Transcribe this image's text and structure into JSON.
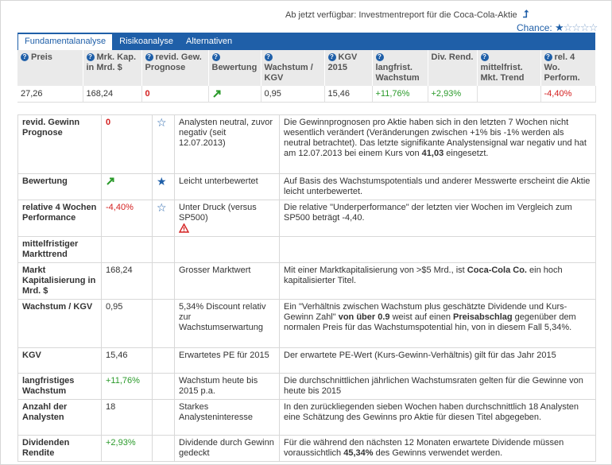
{
  "header": {
    "report_link": "Ab jetzt verfügbar: Investmentreport für die Coca-Cola-Aktie",
    "chance_label": "Chance:",
    "chance_stars_filled": 1,
    "chance_stars_total": 5
  },
  "tabs": [
    {
      "label": "Fundamentalanalyse",
      "active": true
    },
    {
      "label": "Risikoanalyse",
      "active": false
    },
    {
      "label": "Alternativen",
      "active": false
    }
  ],
  "summary": {
    "headers": [
      "Preis",
      "Mrk. Kap. in Mrd. $",
      "revid. Gew. Prognose",
      "Bewertung",
      "Wachstum / KGV",
      "KGV 2015",
      "langfrist. Wachstum",
      "Div. Rend.",
      "mittelfrist. Mkt. Trend",
      "rel. 4 Wo. Perform."
    ],
    "values": {
      "preis": "27,26",
      "mrk_kap": "168,24",
      "revid": "0",
      "bewertung": "",
      "wachstum_kgv": "0,95",
      "kgv": "15,46",
      "langfrist": "+11,76%",
      "div_rend": "+2,93%",
      "mittelfrist": "",
      "rel_perf": "-4,40%"
    }
  },
  "detail": {
    "rows": [
      {
        "label": "revid. Gewinn Prognose",
        "value": "0",
        "star": "empty",
        "short": "Analysten neutral, zuvor negativ (seit 12.07.2013)",
        "long_a": "Die Gewinnprognosen pro Aktie haben sich in den letzten 7 Wochen nicht wesentlich verändert (Veränderungen zwischen +1% bis -1% werden als neutral betrachtet). Das letzte signifikante Analystensignal war negativ und hat am 12.07.2013 bei einem Kurs von ",
        "long_b": "41,03",
        "long_c": " eingesetzt."
      },
      {
        "label": "Bewertung",
        "value": "",
        "star": "filled",
        "short": "Leicht unterbewertet",
        "long": "Auf Basis des Wachstumspotentials und anderer Messwerte erscheint die Aktie leicht unterbewertet."
      },
      {
        "label": "relative 4 Wochen Performance",
        "value": "-4,40%",
        "star": "empty",
        "short": "Unter Druck (versus SP500)",
        "long": "Die relative \"Underperformance\" der letzten vier Wochen im Vergleich zum SP500 beträgt -4,40."
      },
      {
        "label": "mittelfristiger Markttrend",
        "value": "",
        "star": "",
        "short": "",
        "long": ""
      },
      {
        "label": "Markt Kapitalisierung in Mrd. $",
        "value": "168,24",
        "star": "",
        "short": "Grosser Marktwert",
        "long_a": "Mit einer Marktkapitalisierung von >$5 Mrd., ist ",
        "long_b": "Coca-Cola Co.",
        "long_c": " ein hoch kapitalisierter Titel."
      },
      {
        "label": "Wachstum / KGV",
        "value": "0,95",
        "star": "",
        "short": "5,34% Discount relativ zur Wachstumserwartung",
        "long_a": "Ein \"Verhältnis zwischen Wachstum plus geschätzte Dividende und Kurs-Gewinn Zahl\" ",
        "long_b": "von über 0.9",
        "long_c": " weist auf einen ",
        "long_d": "Preisabschlag",
        "long_e": " gegenüber dem normalen Preis für das Wachstumspotential hin, von in diesem Fall 5,34%."
      },
      {
        "label": "KGV",
        "value": "15,46",
        "star": "",
        "short": "Erwartetes PE für 2015",
        "long": "Der erwartete PE-Wert (Kurs-Gewinn-Verhältnis) gilt für das Jahr 2015"
      },
      {
        "label": "langfristiges Wachstum",
        "value": "+11,76%",
        "star": "",
        "short": "Wachstum heute bis 2015 p.a.",
        "long": "Die durchschnittlichen jährlichen Wachstumsraten gelten für die Gewinne von heute bis 2015"
      },
      {
        "label": "Anzahl der Analysten",
        "value": "18",
        "star": "",
        "short": "Starkes Analysteninteresse",
        "long": "In den zurückliegenden sieben Wochen haben durchschnittlich 18 Analysten eine Schätzung des Gewinns pro Aktie für diesen Titel abgegeben."
      },
      {
        "label": "Dividenden Rendite",
        "value": "+2,93%",
        "star": "",
        "short": "Dividende durch Gewinn gedeckt",
        "long_a": "Für die während den nächsten 12 Monaten erwartete Dividende müssen voraussichtlich ",
        "long_b": "45,34%",
        "long_c": " des Gewinns verwendet werden."
      }
    ]
  },
  "colors": {
    "accent": "#1f5fa8",
    "positive": "#2a9a2a",
    "negative": "#d42020"
  }
}
